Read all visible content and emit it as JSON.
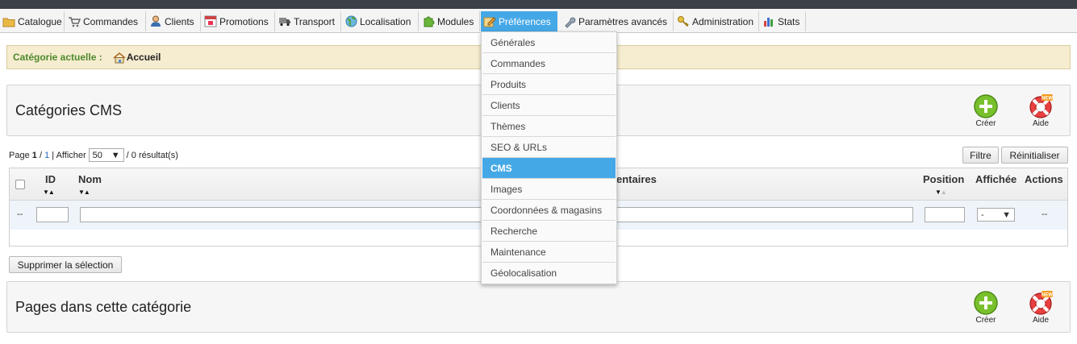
{
  "menu": {
    "tabs": [
      {
        "label": "Catalogue",
        "icon": "folder-icon"
      },
      {
        "label": "Commandes",
        "icon": "cart-icon"
      },
      {
        "label": "Clients",
        "icon": "user-icon"
      },
      {
        "label": "Promotions",
        "icon": "promotion-icon"
      },
      {
        "label": "Transport",
        "icon": "truck-icon"
      },
      {
        "label": "Localisation",
        "icon": "globe-icon"
      },
      {
        "label": "Modules",
        "icon": "puzzle-icon"
      },
      {
        "label": "Préférences",
        "icon": "edit-icon",
        "active": true
      },
      {
        "label": "Paramètres avancés",
        "icon": "wrench-icon"
      },
      {
        "label": "Administration",
        "icon": "key-icon"
      },
      {
        "label": "Stats",
        "icon": "chart-icon"
      }
    ],
    "active_color": "#45a8e6"
  },
  "dropdown": {
    "items": [
      "Générales",
      "Commandes",
      "Produits",
      "Clients",
      "Thèmes",
      "SEO & URLs",
      "CMS",
      "Images",
      "Coordonnées & magasins",
      "Recherche",
      "Maintenance",
      "Géolocalisation"
    ],
    "active": "CMS"
  },
  "breadcrumb": {
    "label": "Catégorie actuelle :",
    "home": "Accueil"
  },
  "categories_panel": {
    "title": "Catégories CMS",
    "create_label": "Créer",
    "help_label": "Aide"
  },
  "pager": {
    "page_word": "Page",
    "page": "1",
    "sep": "/",
    "total_pages": "1",
    "show_label": "| Afficher",
    "per_page": "50",
    "results": "/ 0 résultat(s)"
  },
  "filters": {
    "filter_label": "Filtre",
    "reset_label": "Réinitialiser"
  },
  "table": {
    "columns": {
      "id": "ID",
      "name": "Nom",
      "comments": "entaires",
      "position": "Position",
      "displayed": "Affichée",
      "actions": "Actions"
    },
    "filter_row": {
      "dash": "--",
      "displayed_value": "-",
      "actions_dash": "--"
    }
  },
  "bulk_delete_label": "Supprimer la sélection",
  "pages_panel": {
    "title": "Pages dans cette catégorie",
    "create_label": "Créer",
    "help_label": "Aide"
  }
}
